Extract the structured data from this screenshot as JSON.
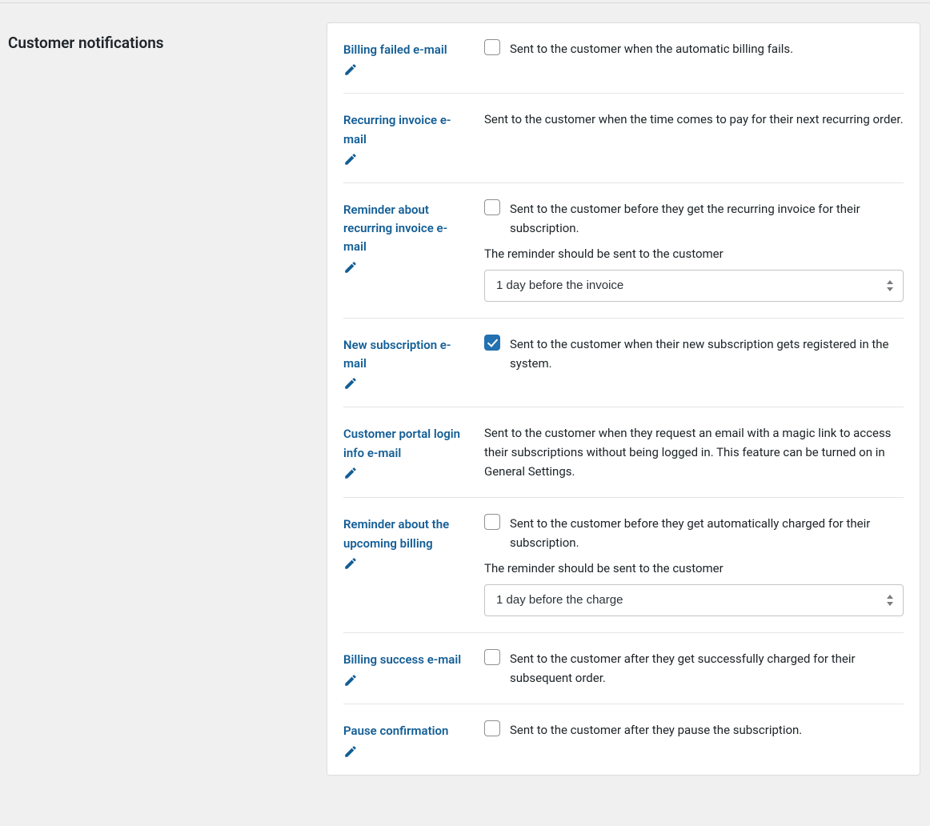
{
  "section_title": "Customer notifications",
  "rows": [
    {
      "id": "billing-failed",
      "label": "Billing failed e-mail",
      "has_checkbox": true,
      "checked": false,
      "description": "Sent to the customer when the automatic billing fails."
    },
    {
      "id": "recurring-invoice",
      "label": "Recurring invoice e-mail",
      "has_checkbox": false,
      "description": "Sent to the customer when the time comes to pay for their next recurring order."
    },
    {
      "id": "reminder-recurring-invoice",
      "label": "Reminder about recurring invoice e-mail",
      "has_checkbox": true,
      "checked": false,
      "description": "Sent to the customer before they get the recurring invoice for their subscription.",
      "sub_note": "The reminder should be sent to the customer",
      "select_value": "1 day before the invoice"
    },
    {
      "id": "new-subscription",
      "label": "New subscription e-mail",
      "has_checkbox": true,
      "checked": true,
      "description": "Sent to the customer when their new subscription gets registered in the system."
    },
    {
      "id": "customer-portal-login",
      "label": "Customer portal login info e-mail",
      "has_checkbox": false,
      "description": "Sent to the customer when they request an email with a magic link to access their subscriptions without being logged in. This feature can be turned on in General Settings."
    },
    {
      "id": "reminder-upcoming-billing",
      "label": "Reminder about the upcoming billing",
      "has_checkbox": true,
      "checked": false,
      "description": "Sent to the customer before they get automatically charged for their subscription.",
      "sub_note": "The reminder should be sent to the customer",
      "select_value": "1 day before the charge"
    },
    {
      "id": "billing-success",
      "label": "Billing success e-mail",
      "has_checkbox": true,
      "checked": false,
      "description": "Sent to the customer after they get successfully charged for their subsequent order."
    },
    {
      "id": "pause-confirmation",
      "label": "Pause confirmation",
      "has_checkbox": true,
      "checked": false,
      "description": "Sent to the customer after they pause the subscription."
    }
  ]
}
